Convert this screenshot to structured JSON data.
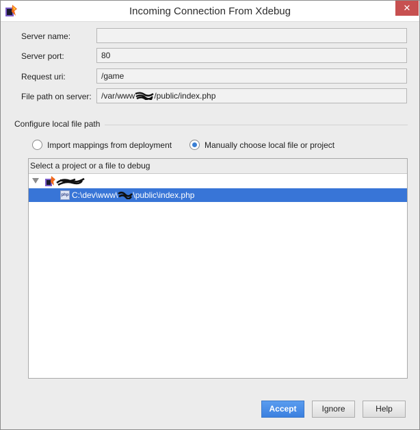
{
  "window": {
    "title": "Incoming Connection From Xdebug",
    "close_glyph": "✕",
    "app_icon": "phpstorm-logo-icon"
  },
  "form": {
    "server_name": {
      "label": "Server name:",
      "value": ""
    },
    "server_port": {
      "label": "Server port:",
      "value": "80"
    },
    "request_uri": {
      "label": "Request uri:",
      "value": "/game"
    },
    "file_path": {
      "label": "File path on server:",
      "value_prefix": "/var/www",
      "value_suffix": "/public/index.php"
    }
  },
  "configure": {
    "section_title": "Configure local file path",
    "options": [
      {
        "label": "Import mappings from deployment",
        "checked": false
      },
      {
        "label": "Manually choose local file or project",
        "checked": true
      }
    ]
  },
  "tree": {
    "header": "Select a project or a file to debug",
    "file_item": {
      "icon_label": "php",
      "prefix": "C:\\dev\\www\\",
      "suffix": "\\public\\index.php",
      "selected": true
    }
  },
  "buttons": {
    "accept": "Accept",
    "ignore": "Ignore",
    "help": "Help"
  },
  "colors": {
    "selection": "#3875d7",
    "accept": "#3b80df",
    "close": "#c75050"
  }
}
